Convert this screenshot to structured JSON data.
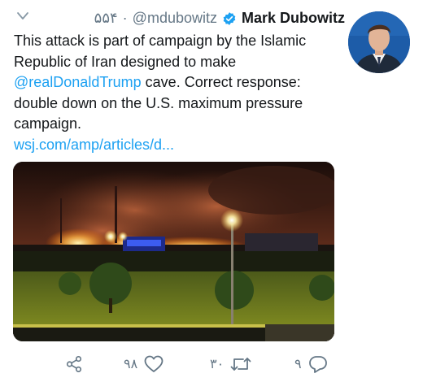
{
  "tweet": {
    "time": "۵۵۴",
    "dot": "·",
    "handle": "@mdubowitz",
    "name": "Mark Dubowitz",
    "text_before": "This attack is part of campaign by the Islamic Republic of Iran designed to make ",
    "mention": "@realDonaldTrump",
    "text_after": " cave. Correct response: double down on the U.S. maximum pressure campaign.",
    "link": "wsj.com/amp/articles/d..."
  },
  "actions": {
    "likes": "۹۸",
    "retweets": "۳۰",
    "replies": "۹"
  },
  "icons": {
    "menu": "chevron-down-icon",
    "verified": "verified-badge-icon",
    "share": "share-icon",
    "like": "heart-icon",
    "retweet": "retweet-icon",
    "reply": "reply-icon"
  },
  "colors": {
    "link": "#1da1f2",
    "muted": "#657786",
    "text": "#14171a"
  }
}
